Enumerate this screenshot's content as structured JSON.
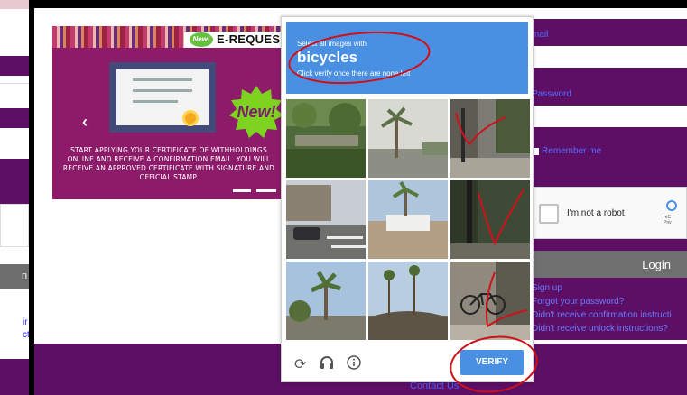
{
  "left_window": {
    "labels": [
      "ir",
      "ct"
    ],
    "button_label": "n"
  },
  "banner": {
    "badge_small": "New!",
    "title": "E-REQUES",
    "badge_big": "New!",
    "prev_arrow": "‹",
    "text": "START APPLYING YOUR CERTIFICATE OF WITHHOLDINGS ONLINE AND RECEIVE A CONFIRMATION EMAIL. YOU WILL RECEIVE AN APPROVED CERTIFICATE WITH SIGNATURE AND OFFICIAL STAMP.",
    "colors": {
      "background": "#8d1b6a",
      "certificate_frame": "#414a78",
      "badge": "#64c13d"
    }
  },
  "login_form": {
    "email_label": "mail",
    "password_label": "Password",
    "remember_label": "Remember me",
    "recaptcha": {
      "label": "I'm not a robot",
      "brand_lines": [
        "reC",
        "Priv"
      ]
    },
    "login_button": "Login",
    "links": [
      "Sign up",
      "Forgot your password?",
      "Didn't receive confirmation instructi",
      "Didn't receive unlock instructions?"
    ],
    "colors": {
      "panel": "#5c0f64",
      "link": "#6a7aff",
      "button": "#6f6f6f"
    }
  },
  "captcha": {
    "instruction_pre": "Select all images with",
    "target": "bicycles",
    "instruction_post": "Click verify once there are none left",
    "icons": [
      "refresh-icon",
      "headphones-icon",
      "info-icon"
    ],
    "verify_button": "VERIFY",
    "colors": {
      "header": "#4a90e2",
      "verify": "#4a90e2"
    }
  },
  "footer": {
    "contact_link": "Contact Us",
    "color": "#5c0f64"
  }
}
